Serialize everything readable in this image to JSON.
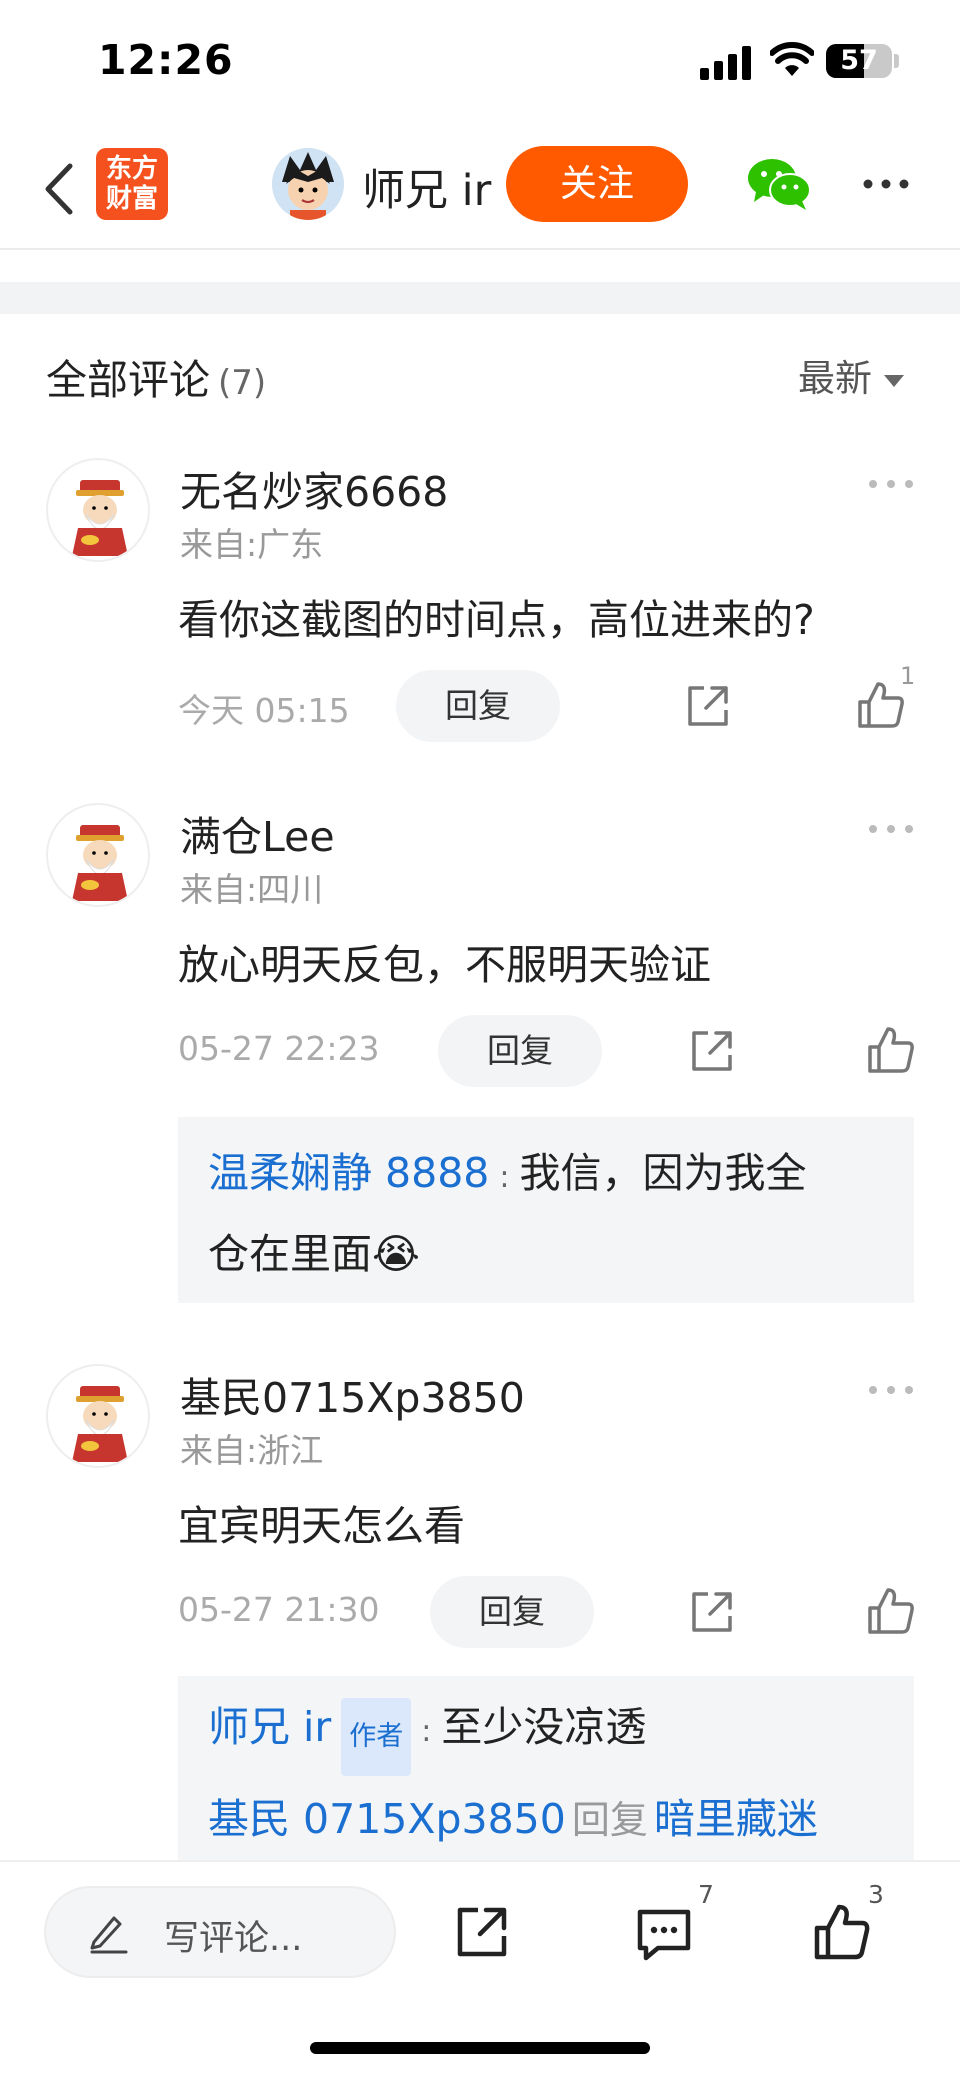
{
  "status_bar": {
    "time": "12:26",
    "battery": "57"
  },
  "nav": {
    "logo_line1": "东方",
    "logo_line2": "财富",
    "author_name": "师兄 ir",
    "follow_label": "关注",
    "icons": [
      "back-icon",
      "wechat-icon",
      "more-icon"
    ]
  },
  "comments_header": {
    "title": "全部评论",
    "count": "(7)",
    "sort_label": "最新"
  },
  "comments": [
    {
      "name": "无名炒家6668",
      "location": "来自:广东",
      "text": "看你这截图的时间点，高位进来的?",
      "time": "今天 05:15",
      "reply_label": "回复",
      "likes": "1"
    },
    {
      "name": "满仓Lee",
      "location": "来自:四川",
      "text": "放心明天反包，不服明天验证",
      "time": "05-27 22:23",
      "reply_label": "回复",
      "replies": [
        {
          "name": "温柔娴静 8888",
          "colon": ":",
          "text_line1": "我信，因为我全",
          "text_line2": "仓在里面",
          "emoji": "😭"
        }
      ]
    },
    {
      "name": "基民0715Xp3850",
      "location": "来自:浙江",
      "text": "宜宾明天怎么看",
      "time": "05-27 21:30",
      "reply_label": "回复",
      "replies": [
        {
          "name": "师兄 ir",
          "tag": "作者",
          "colon": ":",
          "text": "至少没凉透"
        },
        {
          "name": "基民 0715Xp3850",
          "reply_word": "回复",
          "target": "暗里藏迷"
        }
      ]
    }
  ],
  "bottom_bar": {
    "write_placeholder": "写评论...",
    "comment_count": "7",
    "like_count": "3"
  },
  "colors": {
    "accent_orange": "#ff5a00",
    "link_blue": "#1a6fd1",
    "logo_red": "#f4511e"
  }
}
